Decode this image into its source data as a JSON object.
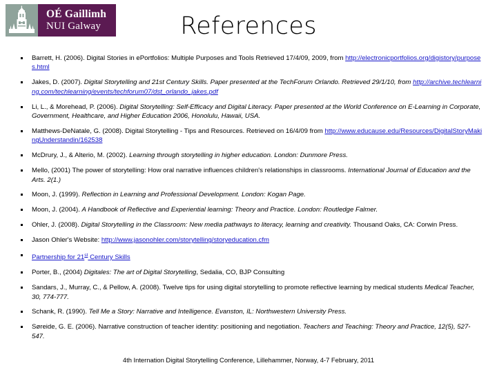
{
  "logo": {
    "crest_icon": "university-tower-crest",
    "crest_bg": "#8fa39b",
    "word_bg": "#5b1a52",
    "line1": "OÉ Gaillimh",
    "line2": "NUI Galway"
  },
  "title": "References",
  "link_color": "#1414c8",
  "references": [
    {
      "id": "barrett-2006",
      "parts": [
        {
          "text": "Barrett, H. (2006).  Digital Stories in ePortfolios: Multiple Purposes and Tools Retrieved 17/4/09, 2009, from ",
          "style": "normal"
        },
        {
          "text": "http://electronicportfolios.org/digistory/purposes.html",
          "style": "link"
        }
      ]
    },
    {
      "id": "jakes-2007",
      "parts": [
        {
          "text": "Jakes, D. (2007). ",
          "style": "normal"
        },
        {
          "text": "Digital Storytelling and 21st Century Skills. Paper presented at the TechForum Orlando. Retrieved 29/1/10, from ",
          "style": "italic"
        },
        {
          "text": "http://archive.techlearning.com/techlearning/events/techforum07/dst_orlando_jakes.pdf",
          "style": "link-italic"
        }
      ]
    },
    {
      "id": "li-morehead-2006",
      "parts": [
        {
          "text": "Li, L., & Morehead, P. (2006). ",
          "style": "normal"
        },
        {
          "text": "Digital Storytelling: Self-Efficacy and Digital Literacy. Paper presented at the World Conference on E-Learning in Corporate, Government, Healthcare, and Higher Education 2006, Honolulu, Hawaii, USA.",
          "style": "italic"
        }
      ]
    },
    {
      "id": "matthews-denatale-2008",
      "parts": [
        {
          "text": "Matthews-DeNatale, G. (2008). Digital Storytelling - Tips and Resources.  Retrieved on 16/4/09 from ",
          "style": "normal"
        },
        {
          "text": "http://www.educause.edu/Resources/DigitalStoryMakingUnderstandin/162538",
          "style": "link"
        }
      ]
    },
    {
      "id": "mcdrury-alterio-2002",
      "parts": [
        {
          "text": "McDrury, J., & Alterio, M. (2002). ",
          "style": "normal"
        },
        {
          "text": "Learning through storytelling in higher education. London: Dunmore Press.",
          "style": "italic"
        }
      ]
    },
    {
      "id": "mello-2001",
      "parts": [
        {
          "text": "Mello, (2001) The power of storytelling: How oral narrative influences children's relationships in classrooms.  ",
          "style": "normal"
        },
        {
          "text": "International Journal of Education and the Arts. ",
          "style": "italic"
        },
        {
          "text": "2(1.)",
          "style": "italic"
        }
      ]
    },
    {
      "id": "moon-1999",
      "parts": [
        {
          "text": "Moon, J. (1999). ",
          "style": "normal"
        },
        {
          "text": "Reflection in Learning and Professional Development. London: Kogan Page.",
          "style": "italic"
        }
      ]
    },
    {
      "id": "moon-2004",
      "parts": [
        {
          "text": "Moon, J. (2004). ",
          "style": "normal"
        },
        {
          "text": "A Handbook of Reflective and Experiential learning: Theory and Practice. London: Routledge Falmer.",
          "style": "italic"
        }
      ]
    },
    {
      "id": "ohler-2008",
      "parts": [
        {
          "text": "Ohler, J. (2008).  ",
          "style": "normal"
        },
        {
          "text": "Digital Storytelling in the Classroom: New media pathways to literacy, learning and creativity. ",
          "style": "italic"
        },
        {
          "text": "Thousand Oaks, CA: Corwin Press.",
          "style": "normal"
        }
      ]
    },
    {
      "id": "jason-ohler-website",
      "parts": [
        {
          "text": "Jason Ohler's Website: ",
          "style": "normal"
        },
        {
          "text": "http://www.jasonohler.com/storytelling/storyeducation.cfm",
          "style": "link"
        }
      ]
    },
    {
      "id": "partnership-21st-century-skills",
      "parts": [
        {
          "text": "Partnership for 21",
          "style": "link"
        },
        {
          "text": "st",
          "style": "link-sup"
        },
        {
          "text": " Century Skills",
          "style": "link"
        }
      ]
    },
    {
      "id": "porter-2004",
      "parts": [
        {
          "text": "Porter, B., (2004) ",
          "style": "normal"
        },
        {
          "text": "Digitales: The art of Digital Storytelling",
          "style": "italic"
        },
        {
          "text": ", Sedalia, CO, BJP Consulting",
          "style": "normal"
        }
      ]
    },
    {
      "id": "sandars-2008",
      "parts": [
        {
          "text": "Sandars, J., Murray, C., & Pellow, A. (2008). Twelve tips for using digital storytelling to promote reflective learning by medical students  ",
          "style": "normal"
        },
        {
          "text": "Medical Teacher, 30, 774-777.",
          "style": "italic"
        }
      ]
    },
    {
      "id": "schank-1990",
      "parts": [
        {
          "text": "Schank, R. (1990). ",
          "style": "normal"
        },
        {
          "text": "Tell Me a Story: Narrative and Intelligence. Evanston, IL: Northwestern University Press.",
          "style": "italic"
        }
      ]
    },
    {
      "id": "soreide-2006",
      "parts": [
        {
          "text": "Søreide, G. E. (2006). Narrative construction of teacher identity: positioning and negotiation.  ",
          "style": "normal"
        },
        {
          "text": "Teachers and Teaching: Theory and Practice, 12(5), 527-547.",
          "style": "italic"
        }
      ]
    }
  ],
  "footer": "4th Internation Digital Storytelling Conference, Lillehammer, Norway, 4-7 February, 2011"
}
